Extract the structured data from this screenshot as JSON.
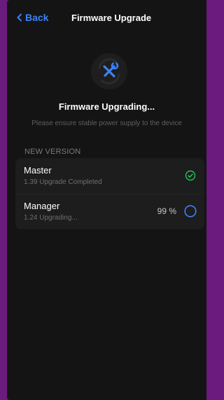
{
  "nav": {
    "back_label": "Back",
    "title": "Firmware Upgrade"
  },
  "status": {
    "title": "Firmware Upgrading...",
    "subtitle": "Please ensure stable power supply to the device",
    "icon": "tools-icon"
  },
  "section": {
    "label": "NEW VERSION"
  },
  "devices": [
    {
      "name": "Master",
      "detail": "1.39 Upgrade Completed",
      "state": "completed",
      "icon": "check-circle-icon"
    },
    {
      "name": "Manager",
      "detail": "1.24 Upgrading...",
      "progress": "99 %",
      "state": "upgrading",
      "icon": "progress-ring-icon"
    }
  ],
  "colors": {
    "accent": "#3b82f6",
    "success": "#22c55e",
    "background": "#141414",
    "card": "#1d1d1d",
    "frame": "#6b1a7e"
  }
}
